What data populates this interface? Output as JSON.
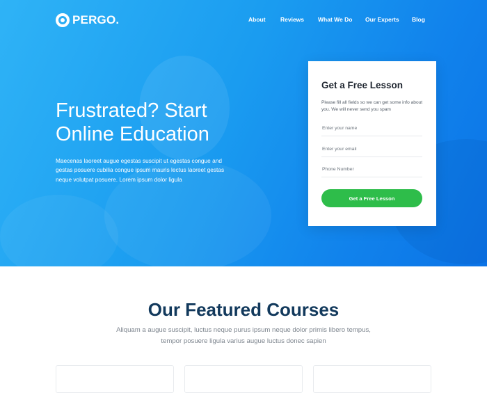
{
  "header": {
    "logo_text": "PERGO.",
    "nav": [
      {
        "label": "About"
      },
      {
        "label": "Reviews"
      },
      {
        "label": "What We Do"
      },
      {
        "label": "Our Experts"
      },
      {
        "label": "Blog"
      }
    ]
  },
  "hero": {
    "title_line1": "Frustrated? Start",
    "title_line2": "Online Education",
    "text": "Maecenas laoreet augue egestas suscipit ut egestas congue and gestas posuere cubilia congue ipsum mauris lectus laoreet gestas neque volutpat posuere. Lorem ipsum dolor ligula"
  },
  "lesson_form": {
    "title": "Get a Free Lesson",
    "description": "Please fill all fields so we can get some info about you. We will never send you spam",
    "name_placeholder": "Enter your name",
    "email_placeholder": "Enter your email",
    "phone_placeholder": "Phone Number",
    "submit_label": "Get a Free Lesson"
  },
  "courses": {
    "title": "Our Featured Courses",
    "subtitle": "Aliquam a augue suscipit, luctus neque purus ipsum neque dolor primis libero tempus, tempor posuere ligula varius augue luctus donec sapien"
  },
  "colors": {
    "hero_gradient_start": "#2fb3f6",
    "hero_gradient_end": "#0b73e6",
    "accent_green": "#2ebd4a",
    "heading_navy": "#12395c"
  }
}
